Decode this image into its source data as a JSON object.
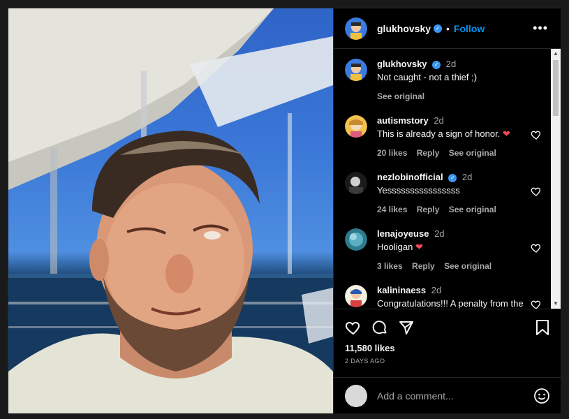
{
  "post": {
    "author": "glukhovsky",
    "follow_label": "Follow",
    "dot": "•",
    "more": "•••"
  },
  "comments": [
    {
      "user": "glukhovsky",
      "time": "2d",
      "text": "Not caught - not a thief ;)",
      "likes": "",
      "reply": "",
      "see_original": "See original",
      "verified": true,
      "author": true
    },
    {
      "user": "autismstory",
      "time": "2d",
      "text": "This is already a sign of honor.",
      "likes": "20 likes",
      "reply": "Reply",
      "see_original": "See original",
      "heart": "❤"
    },
    {
      "user": "nezlobinofficial",
      "time": "2d",
      "text": "Yessssssssssssssss",
      "likes": "24 likes",
      "reply": "Reply",
      "see_original": "See original",
      "verified": true
    },
    {
      "user": "lenajoyeuse",
      "time": "2d",
      "text": "Hooligan",
      "likes": "3 likes",
      "reply": "Reply",
      "see_original": "See original",
      "heart": "❤"
    },
    {
      "user": "kalininaess",
      "time": "2d",
      "text": "Congratulations!!! A penalty from the Russian authorities is now like a",
      "likes": "",
      "reply": "",
      "see_original": ""
    }
  ],
  "stats": {
    "likes": "11,580 likes",
    "date": "2 DAYS AGO"
  },
  "composer": {
    "placeholder": "Add a comment..."
  },
  "colors": {
    "accent": "#0095f6",
    "verified": "#3897f0",
    "heart": "#ed4956"
  }
}
